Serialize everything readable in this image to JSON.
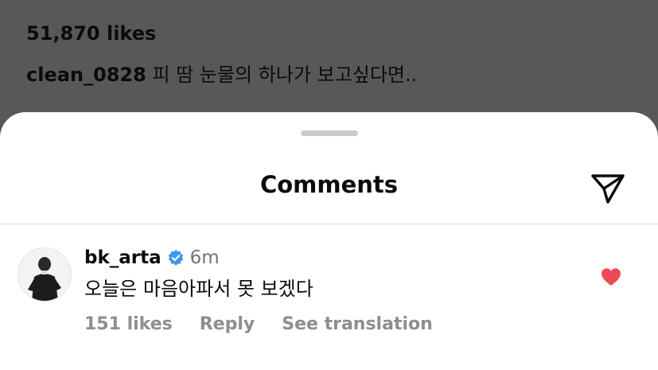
{
  "post": {
    "likes": "51,870 likes",
    "caption_user": "clean_0828",
    "caption_text": "피 땀 눈물의 하나가 보고싶다면.."
  },
  "sheet": {
    "title": "Comments",
    "send_icon": "paper-plane-icon"
  },
  "comment": {
    "username": "bk_arta",
    "verified_icon": "verified-badge-icon",
    "time": "6m",
    "text": "오늘은 마음아파서 못 보겠다",
    "likes": "151 likes",
    "reply": "Reply",
    "see_translation": "See translation",
    "liked": true,
    "heart_color": "#ed4956"
  },
  "colors": {
    "accent_blue": "#3897f0",
    "secondary_text": "#8e8e8e",
    "backdrop": "#585858"
  }
}
